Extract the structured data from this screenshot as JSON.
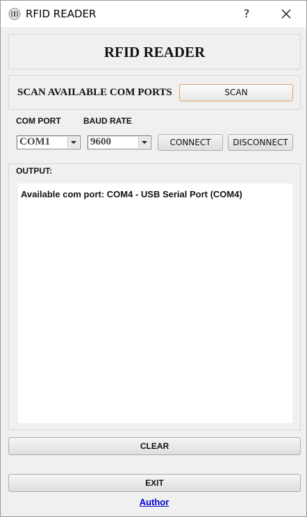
{
  "window": {
    "title": "RFID READER",
    "help_symbol": "?",
    "icon": "rfid-signal-icon"
  },
  "header": {
    "title": "RFID READER"
  },
  "scan": {
    "label": "SCAN AVAILABLE COM PORTS",
    "button_label": "SCAN"
  },
  "connection": {
    "com_port_label": "COM PORT",
    "com_port_value": "COM1",
    "baud_rate_label": "BAUD RATE",
    "baud_rate_value": "9600",
    "connect_label": "CONNECT",
    "disconnect_label": "DISCONNECT"
  },
  "output": {
    "label": "OUTPUT:",
    "lines": [
      "Available com port: COM4 - USB Serial Port (COM4)"
    ]
  },
  "actions": {
    "clear_label": "CLEAR",
    "exit_label": "EXIT",
    "author_link": "Author"
  },
  "colors": {
    "window_bg": "#f0f0f0",
    "titlebar_bg": "#ffffff",
    "scan_button_border": "#e4a36a",
    "link": "#0000cc"
  }
}
